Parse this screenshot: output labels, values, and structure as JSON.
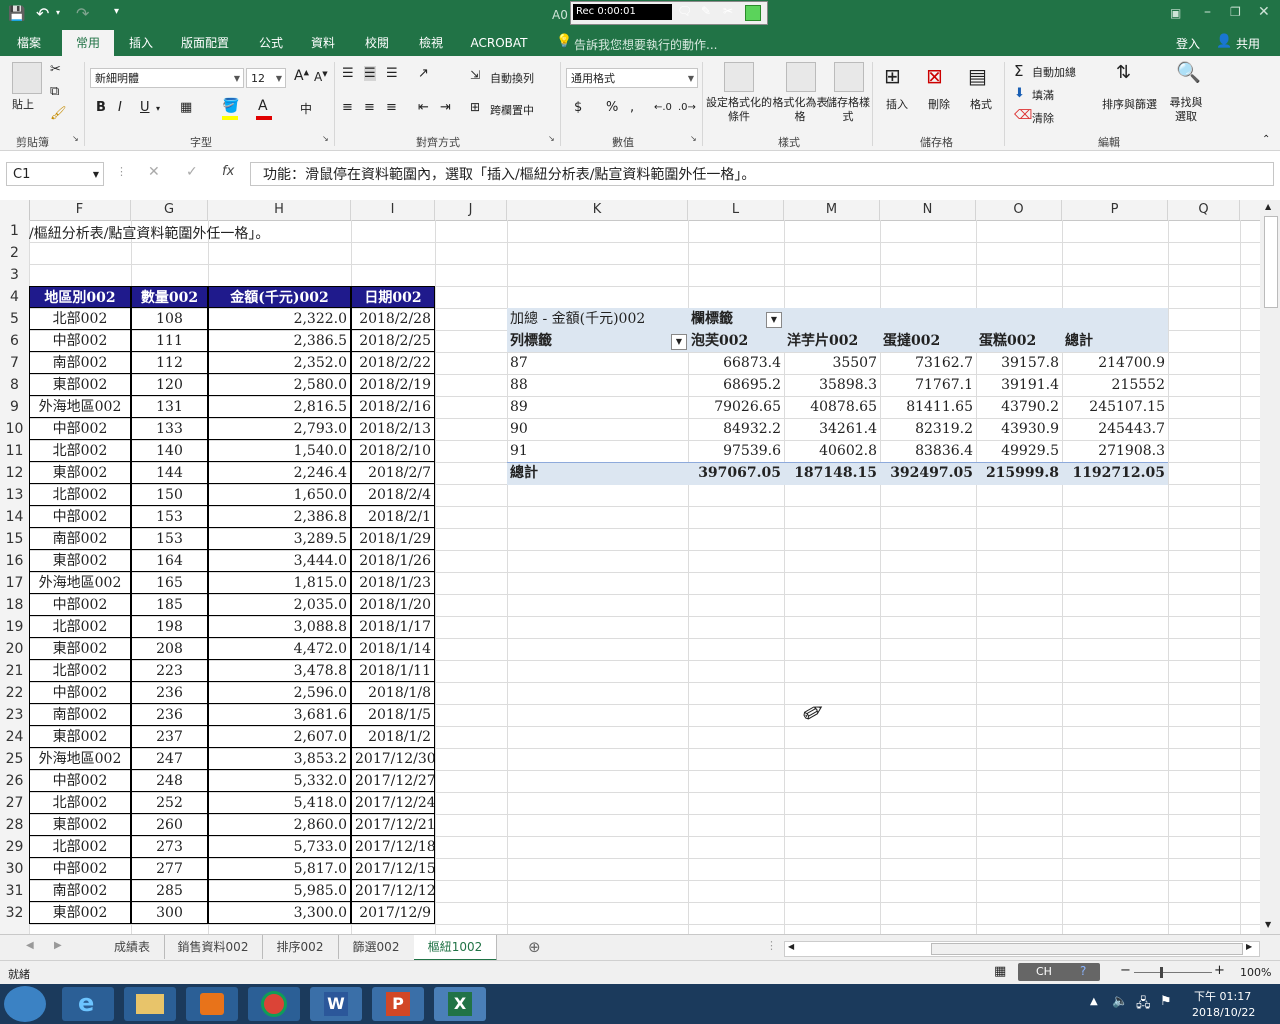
{
  "title_bar": {
    "doc_title": "A0",
    "rec_label": "Rec 0:00:01"
  },
  "tabs": [
    "檔案",
    "常用",
    "插入",
    "版面配置",
    "公式",
    "資料",
    "校閱",
    "檢視",
    "ACROBAT"
  ],
  "tell_me": "告訴我您想要執行的動作...",
  "sign_in": "登入",
  "share": "共用",
  "ribbon": {
    "paste": "貼上",
    "font_name": "新細明體",
    "font_size": "12",
    "bold": "B",
    "italic": "I",
    "underline": "U",
    "wrap_text": "自動換列",
    "merge_center": "跨欄置中",
    "number_format": "通用格式",
    "currency": "$",
    "percent": "%",
    "comma": ",",
    "cond_format": "設定格式化的條件",
    "format_table": "格式化為表格",
    "cell_styles": "儲存格樣式",
    "insert": "插入",
    "delete": "刪除",
    "format": "格式",
    "autosum": "自動加總",
    "fill": "填滿",
    "clear": "清除",
    "sort_filter": "排序與篩選",
    "find_select": "尋找與選取",
    "groups": {
      "clipboard": "剪貼簿",
      "font": "字型",
      "alignment": "對齊方式",
      "number": "數值",
      "styles": "樣式",
      "cells": "儲存格",
      "editing": "編輯"
    }
  },
  "formula_bar": {
    "name_box": "C1",
    "fx": "fx",
    "content": "功能：滑鼠停在資料範圍內，選取「插入/樞紐分析表/點宣資料範圍外任一格」。"
  },
  "columns": [
    "F",
    "G",
    "H",
    "I",
    "J",
    "K",
    "L",
    "M",
    "N",
    "O",
    "P",
    "Q"
  ],
  "rows": [
    "1",
    "2",
    "3",
    "4",
    "5",
    "6",
    "7",
    "8",
    "9",
    "10",
    "11",
    "12",
    "13",
    "14",
    "15",
    "16",
    "17",
    "18",
    "19",
    "20",
    "21",
    "22",
    "23",
    "24",
    "25",
    "26",
    "27",
    "28",
    "29",
    "30",
    "31",
    "32"
  ],
  "row1_text": "/樞紐分析表/點宣資料範圍外任一格」。",
  "table_headers": [
    "地區別002",
    "數量002",
    "金額(千元)002",
    "日期002"
  ],
  "table_rows": [
    [
      "北部002",
      "108",
      "2,322.0",
      "2018/2/28"
    ],
    [
      "中部002",
      "111",
      "2,386.5",
      "2018/2/25"
    ],
    [
      "南部002",
      "112",
      "2,352.0",
      "2018/2/22"
    ],
    [
      "東部002",
      "120",
      "2,580.0",
      "2018/2/19"
    ],
    [
      "外海地區002",
      "131",
      "2,816.5",
      "2018/2/16"
    ],
    [
      "中部002",
      "133",
      "2,793.0",
      "2018/2/13"
    ],
    [
      "北部002",
      "140",
      "1,540.0",
      "2018/2/10"
    ],
    [
      "東部002",
      "144",
      "2,246.4",
      "2018/2/7"
    ],
    [
      "北部002",
      "150",
      "1,650.0",
      "2018/2/4"
    ],
    [
      "中部002",
      "153",
      "2,386.8",
      "2018/2/1"
    ],
    [
      "南部002",
      "153",
      "3,289.5",
      "2018/1/29"
    ],
    [
      "東部002",
      "164",
      "3,444.0",
      "2018/1/26"
    ],
    [
      "外海地區002",
      "165",
      "1,815.0",
      "2018/1/23"
    ],
    [
      "中部002",
      "185",
      "2,035.0",
      "2018/1/20"
    ],
    [
      "北部002",
      "198",
      "3,088.8",
      "2018/1/17"
    ],
    [
      "東部002",
      "208",
      "4,472.0",
      "2018/1/14"
    ],
    [
      "北部002",
      "223",
      "3,478.8",
      "2018/1/11"
    ],
    [
      "中部002",
      "236",
      "2,596.0",
      "2018/1/8"
    ],
    [
      "南部002",
      "236",
      "3,681.6",
      "2018/1/5"
    ],
    [
      "東部002",
      "237",
      "2,607.0",
      "2018/1/2"
    ],
    [
      "外海地區002",
      "247",
      "3,853.2",
      "2017/12/30"
    ],
    [
      "中部002",
      "248",
      "5,332.0",
      "2017/12/27"
    ],
    [
      "北部002",
      "252",
      "5,418.0",
      "2017/12/24"
    ],
    [
      "東部002",
      "260",
      "2,860.0",
      "2017/12/21"
    ],
    [
      "北部002",
      "273",
      "5,733.0",
      "2017/12/18"
    ],
    [
      "中部002",
      "277",
      "5,817.0",
      "2017/12/15"
    ],
    [
      "南部002",
      "285",
      "5,985.0",
      "2017/12/12"
    ],
    [
      "東部002",
      "300",
      "3,300.0",
      "2017/12/9"
    ]
  ],
  "pivot": {
    "value_label": "加總 - 金額(千元)002",
    "col_label": "欄標籤",
    "row_label": "列標籤",
    "col_headers": [
      "泡芙002",
      "洋芋片002",
      "蛋撻002",
      "蛋糕002",
      "總計"
    ],
    "rows": [
      [
        "87",
        "66873.4",
        "35507",
        "73162.7",
        "39157.8",
        "214700.9"
      ],
      [
        "88",
        "68695.2",
        "35898.3",
        "71767.1",
        "39191.4",
        "215552"
      ],
      [
        "89",
        "79026.65",
        "40878.65",
        "81411.65",
        "43790.2",
        "245107.15"
      ],
      [
        "90",
        "84932.2",
        "34261.4",
        "82319.2",
        "43930.9",
        "245443.7"
      ],
      [
        "91",
        "97539.6",
        "40602.8",
        "83836.4",
        "49929.5",
        "271908.3"
      ]
    ],
    "total_row": [
      "總計",
      "397067.05",
      "187148.15",
      "392497.05",
      "215999.8",
      "1192712.05"
    ]
  },
  "sheet_tabs": [
    "成績表",
    "銷售資料002",
    "排序002",
    "篩選002",
    "樞紐1002"
  ],
  "status": {
    "ready": "就緒",
    "zoom": "100%",
    "ime": "CH"
  },
  "clock": {
    "time": "下午 01:17",
    "date": "2018/10/22"
  },
  "colors": {
    "excel_green": "#217346",
    "table_header": "#1f1a8c",
    "pivot_header": "#dce6f1"
  }
}
